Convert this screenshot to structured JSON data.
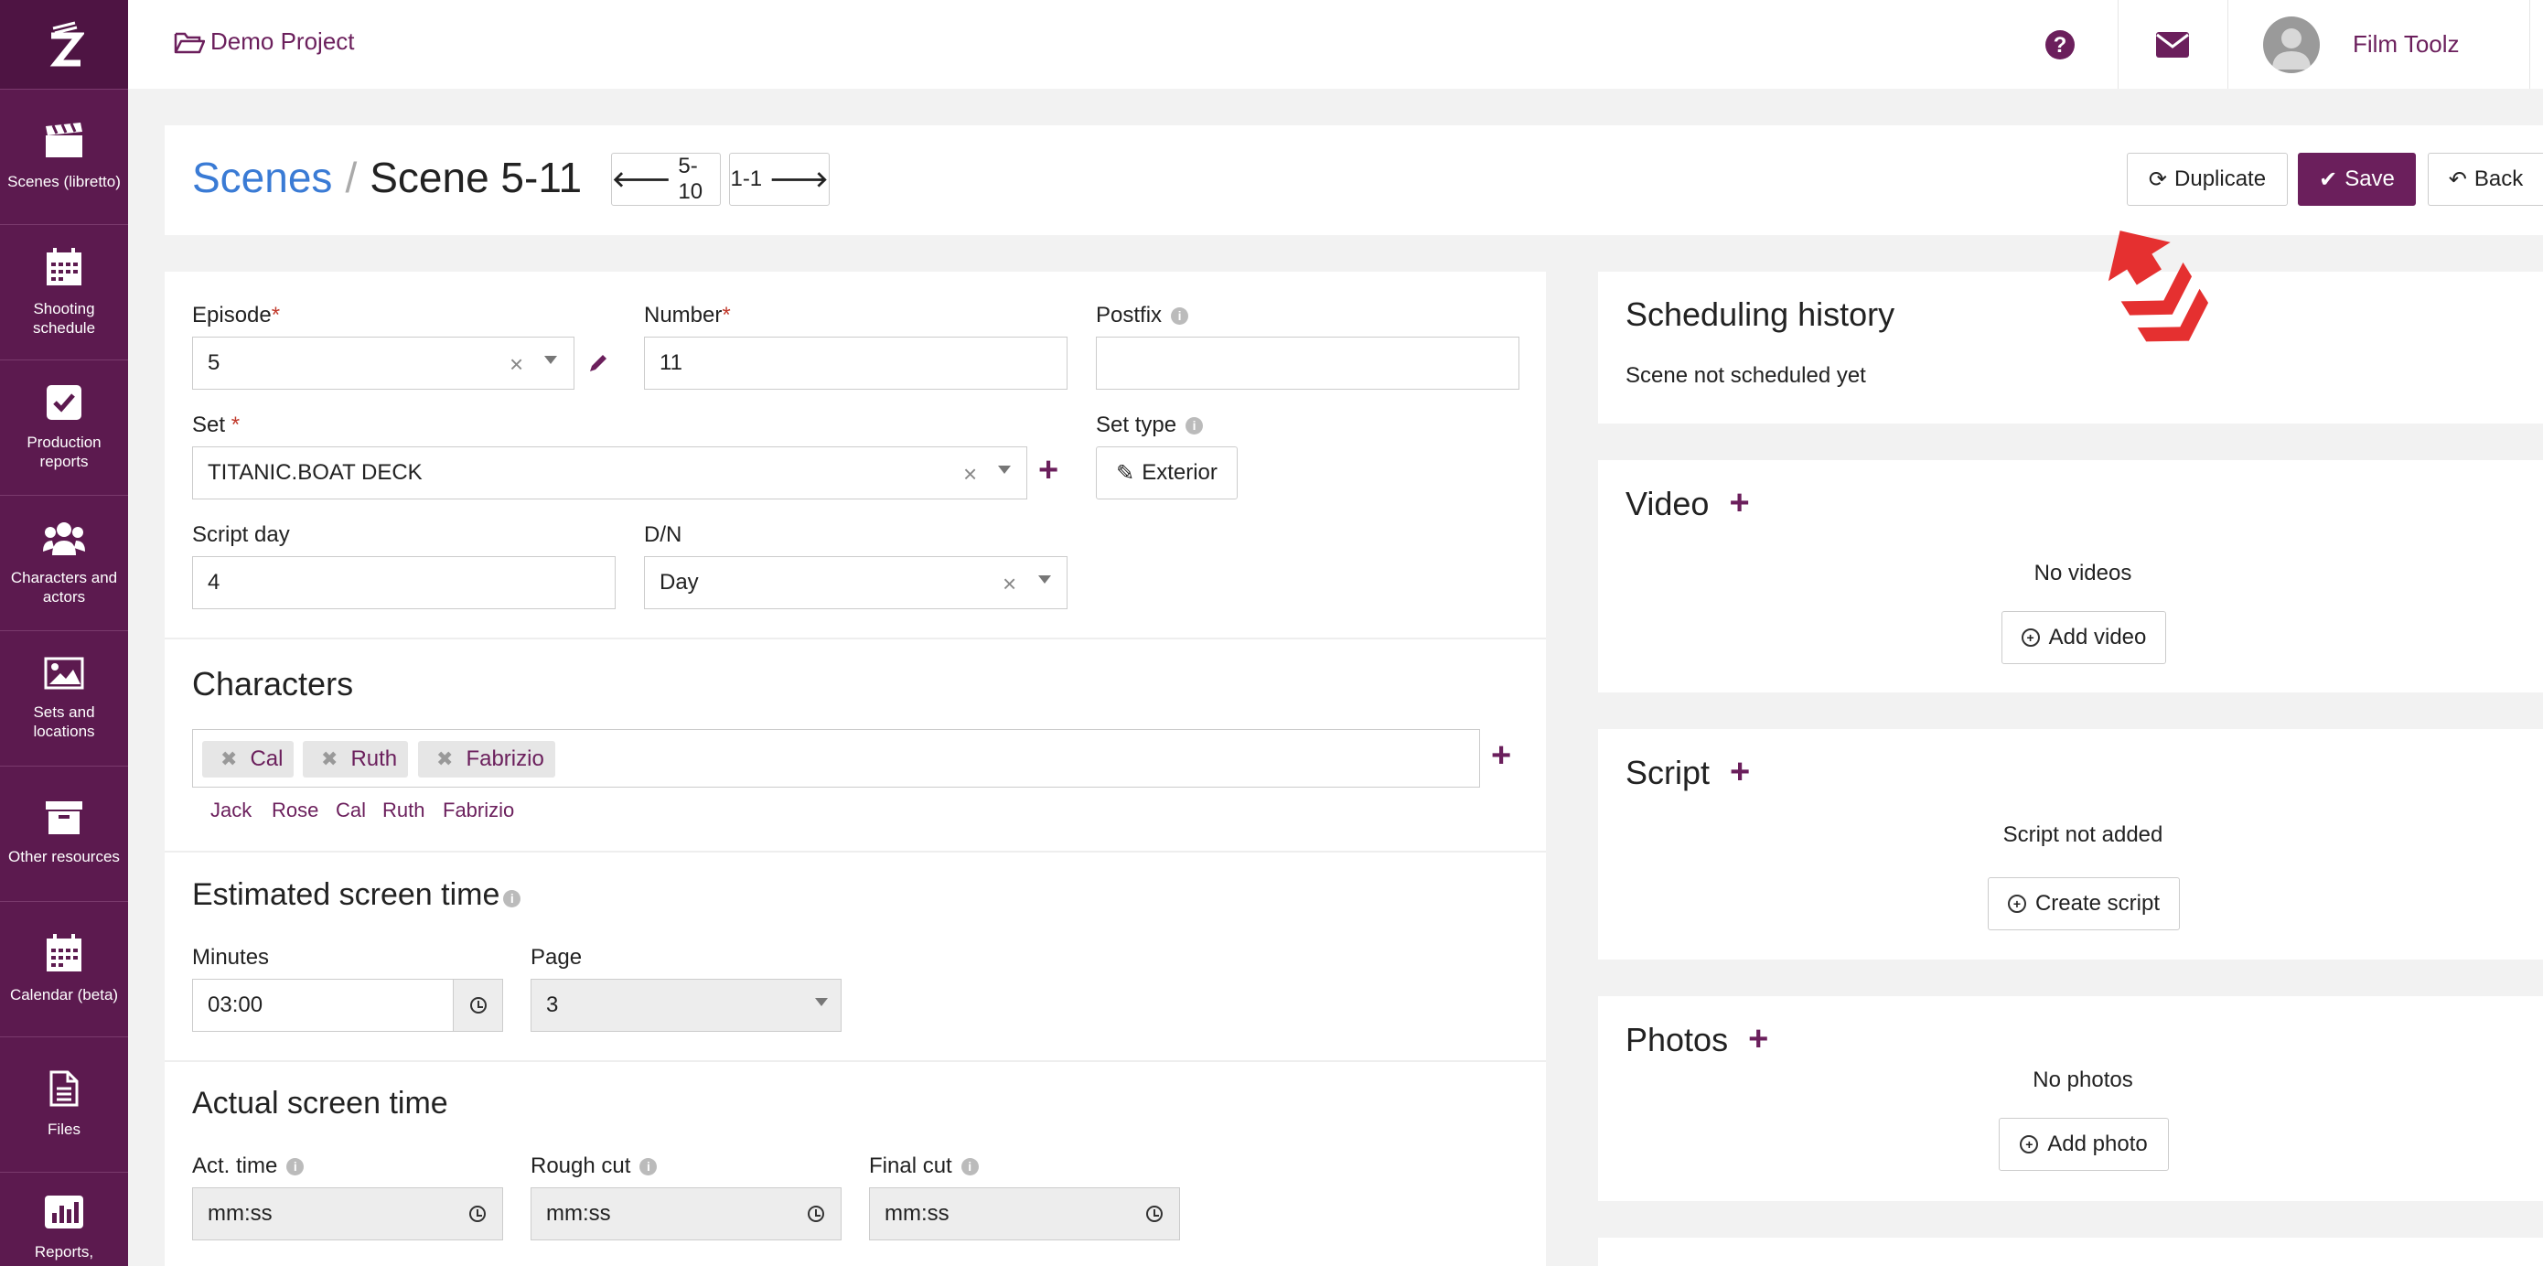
{
  "nav": {
    "items": [
      {
        "label": "Scenes (libretto)",
        "icon": "clapperboard-icon"
      },
      {
        "label": "Shooting schedule",
        "icon": "calendar-icon"
      },
      {
        "label": "Production reports",
        "icon": "check-square-icon"
      },
      {
        "label": "Characters and actors",
        "icon": "users-icon"
      },
      {
        "label": "Sets and locations",
        "icon": "image-icon"
      },
      {
        "label": "Other resources",
        "icon": "archive-icon"
      },
      {
        "label": "Calendar (beta)",
        "icon": "calendar-icon"
      },
      {
        "label": "Files",
        "icon": "file-icon"
      },
      {
        "label": "Reports,",
        "icon": "bar-chart-icon"
      }
    ]
  },
  "topbar": {
    "project": "Demo Project",
    "user": "Film Toolz"
  },
  "header": {
    "breadcrumb_link": "Scenes",
    "breadcrumb_current": "Scene 5-11",
    "prev_label": "5-10",
    "next_label": "1-1",
    "duplicate_label": "Duplicate",
    "save_label": "Save",
    "back_label": "Back"
  },
  "form": {
    "episode_label": "Episode",
    "episode_value": "5",
    "number_label": "Number",
    "number_value": "11",
    "postfix_label": "Postfix",
    "postfix_value": "",
    "set_label": "Set",
    "set_value": "TITANIC.BOAT DECK",
    "settype_label": "Set type",
    "settype_value": "Exterior",
    "scriptday_label": "Script day",
    "scriptday_value": "4",
    "dn_label": "D/N",
    "dn_value": "Day",
    "required_mark": "*"
  },
  "characters": {
    "title": "Characters",
    "selected": [
      "Cal",
      "Ruth",
      "Fabrizio"
    ],
    "suggestions": [
      "Jack",
      "Rose",
      "Cal",
      "Ruth",
      "Fabrizio"
    ]
  },
  "estimated": {
    "title": "Estimated screen time",
    "minutes_label": "Minutes",
    "minutes_value": "03:00",
    "page_label": "Page",
    "page_value": "3"
  },
  "actual": {
    "title": "Actual screen time",
    "act_label": "Act. time",
    "act_placeholder": "mm:ss",
    "rough_label": "Rough cut",
    "rough_placeholder": "mm:ss",
    "final_label": "Final cut",
    "final_placeholder": "mm:ss"
  },
  "right": {
    "scheduling_title": "Scheduling history",
    "scheduling_text": "Scene not scheduled yet",
    "video_title": "Video",
    "video_empty": "No videos",
    "video_button": "Add video",
    "script_title": "Script",
    "script_empty": "Script not added",
    "script_button": "Create script",
    "photos_title": "Photos",
    "photos_empty": "No photos",
    "photos_button": "Add photo"
  },
  "colors": {
    "brand": "#6b1f5c",
    "sidebar": "#5c1a4f",
    "link": "#3a7bd5",
    "annotation_arrow": "#e53030"
  }
}
